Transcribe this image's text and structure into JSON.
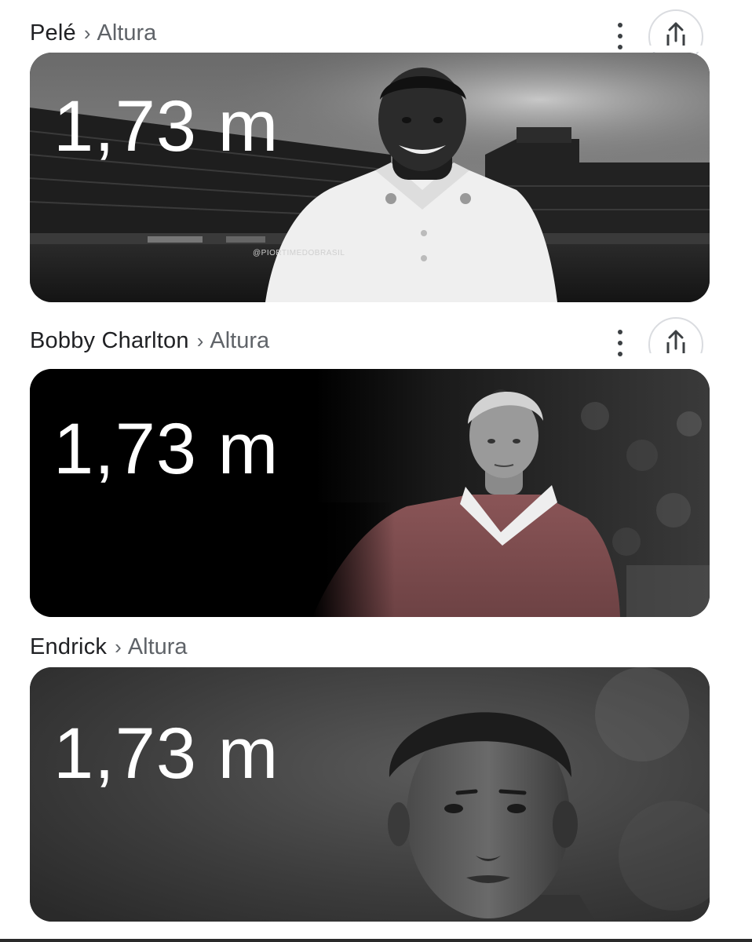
{
  "results": [
    {
      "entity": "Pelé",
      "separator": "›",
      "attribute": "Altura",
      "value": "1,73 m",
      "watermark": "@PIORTIMEDOBRASIL",
      "image_subject": "pele-photo",
      "has_share_button": true
    },
    {
      "entity": "Bobby Charlton",
      "separator": "›",
      "attribute": "Altura",
      "value": "1,73 m",
      "image_subject": "bobby-charlton-photo",
      "has_share_button": true
    },
    {
      "entity": "Endrick",
      "separator": "›",
      "attribute": "Altura",
      "value": "1,73 m",
      "image_subject": "endrick-photo",
      "has_share_button": false
    }
  ],
  "icons": {
    "more": "more-vert-icon",
    "share": "share-icon"
  },
  "colors": {
    "entity_text": "#202124",
    "attribute_text": "#5f6368",
    "value_text": "#ffffff",
    "charlton_shirt": "#7a4a4c"
  }
}
